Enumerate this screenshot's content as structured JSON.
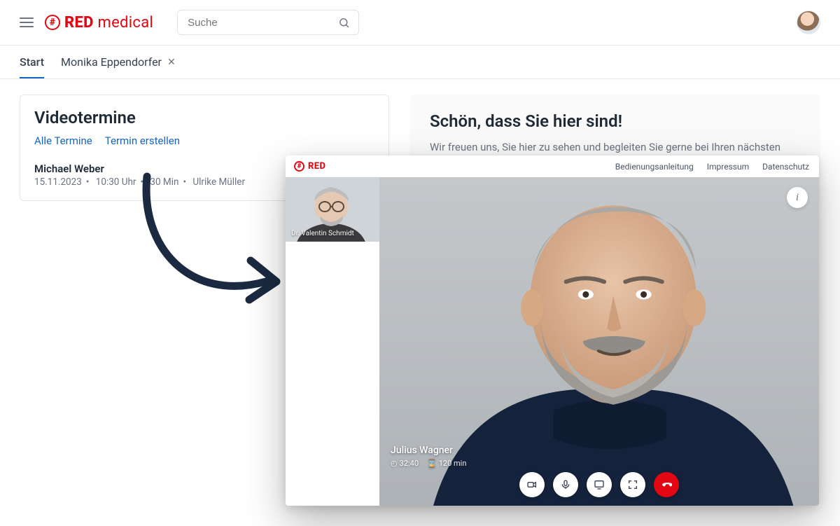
{
  "brand": {
    "bold": "RED",
    "thin": " medical"
  },
  "search": {
    "placeholder": "Suche"
  },
  "tabs": [
    {
      "label": "Start",
      "active": true,
      "closable": false
    },
    {
      "label": "Monika Eppendorfer",
      "active": false,
      "closable": true
    }
  ],
  "appointments": {
    "title": "Videotermine",
    "links": {
      "all": "Alle Termine",
      "create": "Termin erstellen"
    },
    "item": {
      "name": "Michael Weber",
      "date": "15.11.2023",
      "time": "10:30 Uhr",
      "duration": "30 Min",
      "host": "Ulrike Müller"
    }
  },
  "welcome": {
    "title": "Schön, dass Sie hier sind!",
    "body": "Wir freuen uns, Sie hier zu sehen und begleiten Sie gerne bei Ihren nächsten Schritten!"
  },
  "call": {
    "brand": "RED",
    "header_links": {
      "manual": "Bedienungsanleitung",
      "imprint": "Impressum",
      "privacy": "Datenschutz"
    },
    "thumbnail": {
      "name": "Dr. Valentin Schmidt"
    },
    "participant": {
      "name": "Julius Wagner",
      "elapsed": "32:40",
      "remaining": "120 min"
    },
    "info_button": "i"
  }
}
